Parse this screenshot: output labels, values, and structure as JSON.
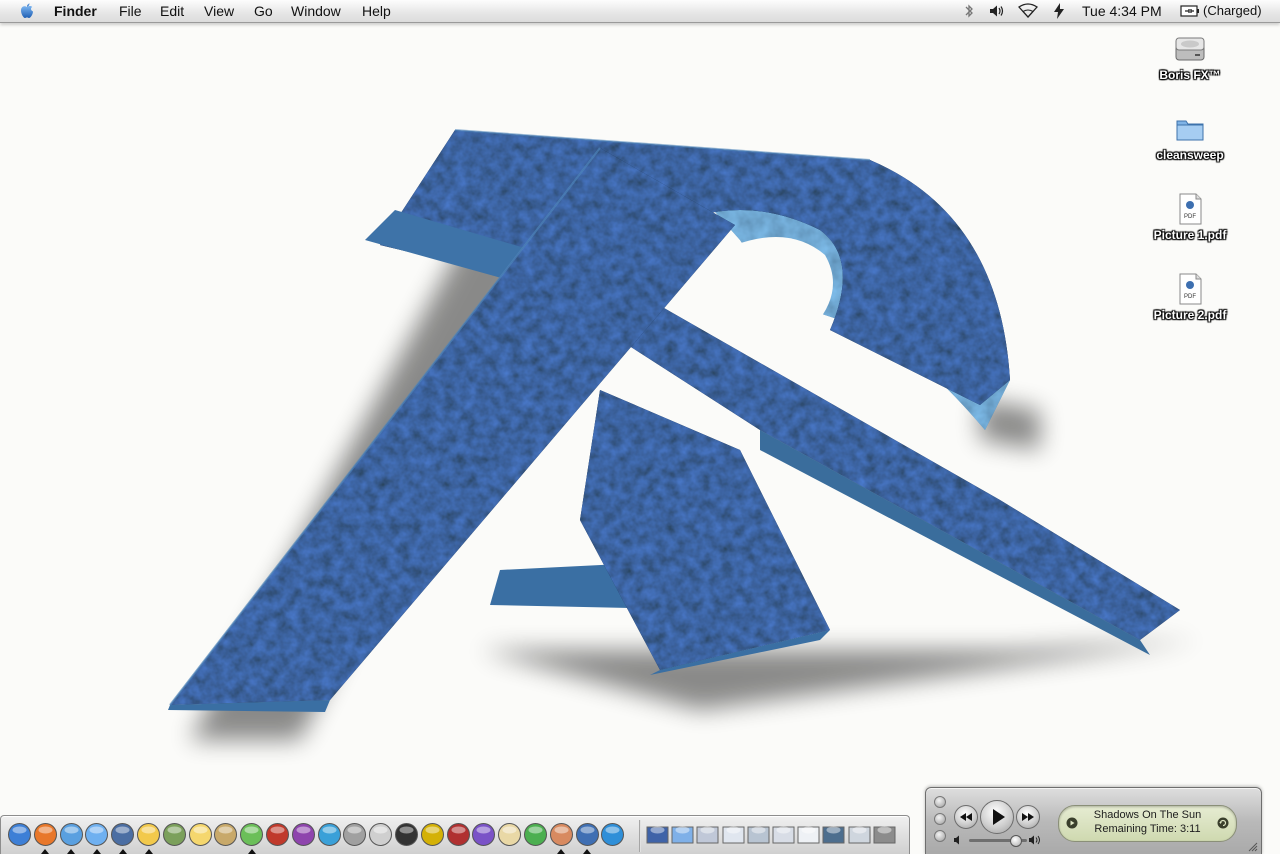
{
  "menubar": {
    "app_name": "Finder",
    "menus": [
      "File",
      "Edit",
      "View",
      "Go",
      "Window",
      "Help"
    ],
    "clock": "Tue 4:34 PM",
    "battery_status": "(Charged)",
    "status_icons": [
      "bluetooth-icon",
      "volume-icon",
      "wifi-icon",
      "sync-icon",
      "battery-icon"
    ]
  },
  "desktop": {
    "icons": [
      {
        "label": "Boris  FX™",
        "icon": "hard-drive-icon"
      },
      {
        "label": "cleansweep",
        "icon": "folder-icon"
      },
      {
        "label": "Picture 1.pdf",
        "icon": "pdf-file-icon"
      },
      {
        "label": "Picture 2.pdf",
        "icon": "pdf-file-icon"
      }
    ],
    "pdf_badge": "PDF",
    "accent_color": "#3a6fa3"
  },
  "dock": {
    "apps": [
      "finder",
      "firefox",
      "safari",
      "ichat",
      "mail-stamp",
      "mail",
      "preview",
      "stickies",
      "address-book",
      "itunes",
      "disk-burner",
      "packages",
      "quicktime",
      "system-preferences",
      "ipod",
      "clapper",
      "final-cut",
      "film-strip",
      "x11",
      "textedit",
      "pen-editor",
      "photo-booth",
      "itunes-music",
      "quicktime-player"
    ],
    "minimized": [
      "window-1",
      "window-2",
      "window-3",
      "window-4",
      "window-5",
      "window-6",
      "window-7",
      "window-8",
      "window-9",
      "trash"
    ]
  },
  "itunes": {
    "track_title": "Shadows On The Sun",
    "remaining": "Remaining Time: 3:11",
    "volume": 0.8
  }
}
